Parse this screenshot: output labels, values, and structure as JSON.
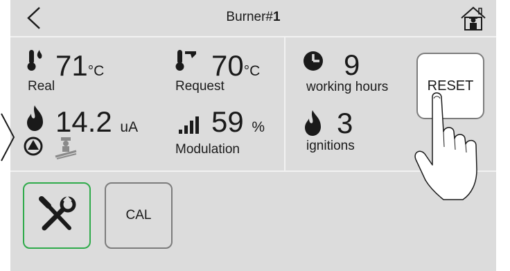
{
  "header": {
    "title_prefix": "Burner#",
    "title_number": "1"
  },
  "status": {
    "real": {
      "value": "71",
      "unit": "°C",
      "label": "Real"
    },
    "request": {
      "value": "70",
      "unit": "°C",
      "label": "Request"
    },
    "flame": {
      "value": "14.2",
      "unit": "uA"
    },
    "modulation": {
      "value": "59",
      "unit": "%",
      "label": "Modulation"
    },
    "hours": {
      "value": "9",
      "label": "working hours"
    },
    "ignitions": {
      "value": "3",
      "label": "ignitions"
    }
  },
  "buttons": {
    "reset": "RESET",
    "cal": "CAL"
  },
  "colors": {
    "panel": "#dcdcdc",
    "accent": "#2eaa4a",
    "border": "#7c7c7c"
  },
  "icons": [
    "back-arrow-icon",
    "home-chimney-sweep-icon",
    "thermometer-flame-icon",
    "thermometer-setpoint-icon",
    "flame-icon",
    "signal-bars-icon",
    "clock-icon",
    "pump-icon",
    "chimney-sweep-icon",
    "tools-icon"
  ]
}
